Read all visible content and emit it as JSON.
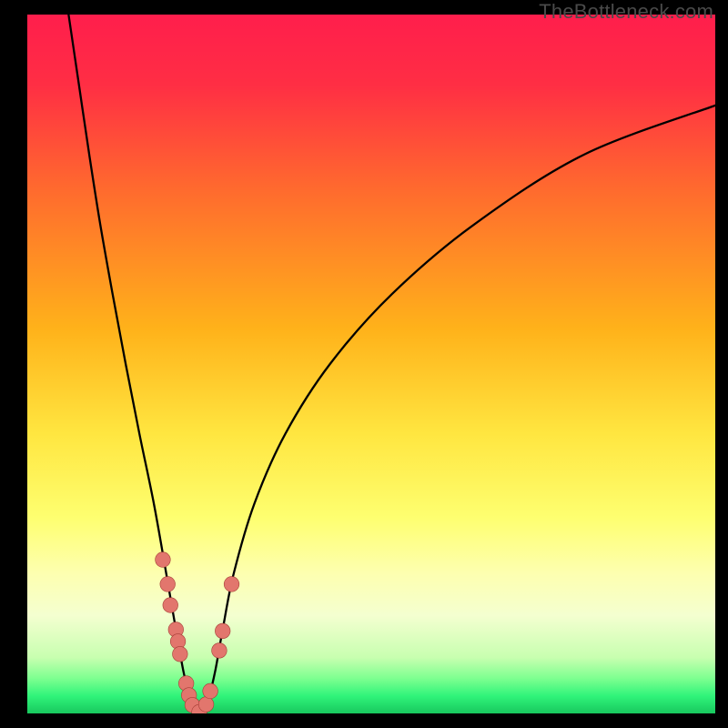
{
  "watermark": "TheBottleneck.com",
  "chart_data": {
    "type": "line",
    "title": "",
    "xlabel": "",
    "ylabel": "",
    "xlim": [
      0,
      100
    ],
    "ylim": [
      0,
      100
    ],
    "background_gradient": {
      "stops": [
        {
          "offset": 0.0,
          "color": "#ff1e4c"
        },
        {
          "offset": 0.1,
          "color": "#ff2e44"
        },
        {
          "offset": 0.25,
          "color": "#ff6a2e"
        },
        {
          "offset": 0.45,
          "color": "#ffb21a"
        },
        {
          "offset": 0.6,
          "color": "#ffe640"
        },
        {
          "offset": 0.72,
          "color": "#feff70"
        },
        {
          "offset": 0.8,
          "color": "#fdffb0"
        },
        {
          "offset": 0.86,
          "color": "#f4ffd0"
        },
        {
          "offset": 0.92,
          "color": "#c8ffb0"
        },
        {
          "offset": 0.95,
          "color": "#7dff90"
        },
        {
          "offset": 0.975,
          "color": "#30f47a"
        },
        {
          "offset": 1.0,
          "color": "#18c85e"
        }
      ]
    },
    "series": [
      {
        "name": "left-curve",
        "values": [
          {
            "x": 6.0,
            "y": 100.0
          },
          {
            "x": 7.5,
            "y": 90.0
          },
          {
            "x": 9.0,
            "y": 80.0
          },
          {
            "x": 10.6,
            "y": 70.0
          },
          {
            "x": 12.4,
            "y": 60.0
          },
          {
            "x": 14.3,
            "y": 50.0
          },
          {
            "x": 16.3,
            "y": 40.0
          },
          {
            "x": 18.4,
            "y": 30.0
          },
          {
            "x": 20.2,
            "y": 20.0
          },
          {
            "x": 21.6,
            "y": 12.0
          },
          {
            "x": 22.7,
            "y": 6.0
          },
          {
            "x": 23.7,
            "y": 2.0
          },
          {
            "x": 24.6,
            "y": 0.2
          }
        ]
      },
      {
        "name": "right-curve",
        "values": [
          {
            "x": 25.4,
            "y": 0.2
          },
          {
            "x": 26.3,
            "y": 2.0
          },
          {
            "x": 27.3,
            "y": 6.0
          },
          {
            "x": 28.4,
            "y": 12.0
          },
          {
            "x": 30.0,
            "y": 20.0
          },
          {
            "x": 33.0,
            "y": 30.0
          },
          {
            "x": 37.5,
            "y": 40.0
          },
          {
            "x": 44.0,
            "y": 50.0
          },
          {
            "x": 53.0,
            "y": 60.0
          },
          {
            "x": 65.0,
            "y": 70.0
          },
          {
            "x": 81.0,
            "y": 80.0
          },
          {
            "x": 100.0,
            "y": 87.0
          }
        ]
      }
    ],
    "markers": [
      {
        "x": 19.7,
        "y": 22.0
      },
      {
        "x": 20.4,
        "y": 18.5
      },
      {
        "x": 20.8,
        "y": 15.5
      },
      {
        "x": 21.6,
        "y": 12.0
      },
      {
        "x": 21.9,
        "y": 10.3
      },
      {
        "x": 22.2,
        "y": 8.5
      },
      {
        "x": 23.1,
        "y": 4.3
      },
      {
        "x": 23.5,
        "y": 2.6
      },
      {
        "x": 24.0,
        "y": 1.2
      },
      {
        "x": 25.0,
        "y": 0.2
      },
      {
        "x": 26.0,
        "y": 1.3
      },
      {
        "x": 26.6,
        "y": 3.2
      },
      {
        "x": 27.9,
        "y": 9.0
      },
      {
        "x": 28.4,
        "y": 11.8
      },
      {
        "x": 29.7,
        "y": 18.5
      }
    ],
    "marker_style": {
      "fill": "#e2766d",
      "stroke": "#a63d36",
      "r_data_units": 1.1
    }
  }
}
